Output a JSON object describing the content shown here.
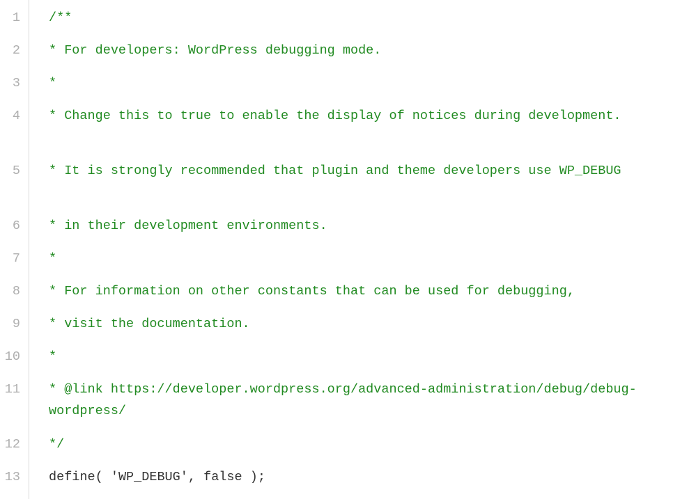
{
  "code": {
    "lines": [
      {
        "num": "1",
        "wrapped": false,
        "segments": [
          {
            "text": "/**",
            "cls": "comment"
          }
        ]
      },
      {
        "num": "2",
        "wrapped": false,
        "segments": [
          {
            "text": " * For developers: WordPress debugging mode.",
            "cls": "comment"
          }
        ]
      },
      {
        "num": "3",
        "wrapped": false,
        "segments": [
          {
            "text": " *",
            "cls": "comment"
          }
        ]
      },
      {
        "num": "4",
        "wrapped": true,
        "segments": [
          {
            "text": " * Change this to true to enable the display of notices during development.",
            "cls": "comment"
          }
        ]
      },
      {
        "num": "5",
        "wrapped": true,
        "segments": [
          {
            "text": " * It is strongly recommended that plugin and theme developers use WP_DEBUG",
            "cls": "comment"
          }
        ]
      },
      {
        "num": "6",
        "wrapped": false,
        "segments": [
          {
            "text": " * in their development environments.",
            "cls": "comment"
          }
        ]
      },
      {
        "num": "7",
        "wrapped": false,
        "segments": [
          {
            "text": " *",
            "cls": "comment"
          }
        ]
      },
      {
        "num": "8",
        "wrapped": false,
        "segments": [
          {
            "text": " * For information on other constants that can be used for debugging,",
            "cls": "comment"
          }
        ]
      },
      {
        "num": "9",
        "wrapped": false,
        "segments": [
          {
            "text": " * visit the documentation.",
            "cls": "comment"
          }
        ]
      },
      {
        "num": "10",
        "wrapped": false,
        "segments": [
          {
            "text": " *",
            "cls": "comment"
          }
        ]
      },
      {
        "num": "11",
        "wrapped": true,
        "segments": [
          {
            "text": " * @link https://developer.wordpress.org/advanced-administration/debug/debug-wordpress/",
            "cls": "comment"
          }
        ]
      },
      {
        "num": "12",
        "wrapped": false,
        "segments": [
          {
            "text": " */",
            "cls": "comment"
          }
        ]
      },
      {
        "num": "13",
        "wrapped": false,
        "segments": [
          {
            "text": "define",
            "cls": "func"
          },
          {
            "text": "( ",
            "cls": "punct"
          },
          {
            "text": "'WP_DEBUG'",
            "cls": "string"
          },
          {
            "text": ", ",
            "cls": "punct"
          },
          {
            "text": "false",
            "cls": "constant"
          },
          {
            "text": " );",
            "cls": "punct"
          }
        ]
      }
    ]
  }
}
